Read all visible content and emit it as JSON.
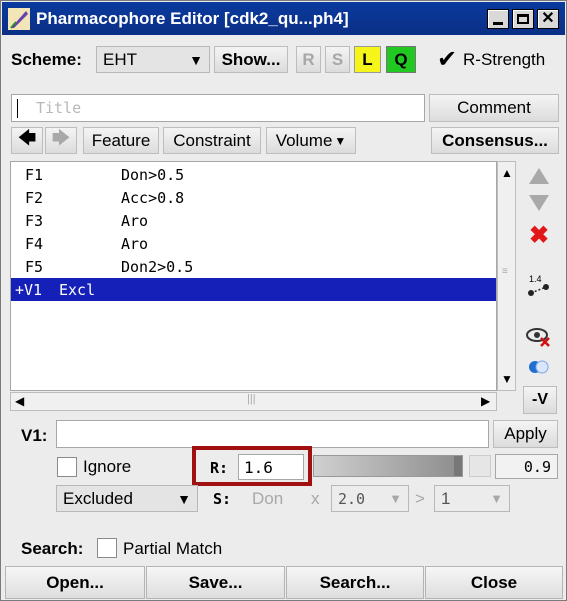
{
  "window": {
    "title": "Pharmacophore Editor [cdk2_qu...ph4]",
    "colors": {
      "titlebar": "#0b3393",
      "selection": "#1520b8",
      "highlight_box": "#a01010",
      "L_button": "#f5f51a",
      "Q_button": "#22c822"
    }
  },
  "toolbar": {
    "scheme_label": "Scheme:",
    "scheme_value": "EHT",
    "show_label": "Show...",
    "r_label": "R",
    "s_label": "S",
    "l_label": "L",
    "q_label": "Q",
    "rstrength_label": "R-Strength"
  },
  "title_field": {
    "placeholder": "Title",
    "value": ""
  },
  "comment_label": "Comment",
  "nav": {
    "feature_label": "Feature",
    "constraint_label": "Constraint",
    "volume_label": "Volume",
    "consensus_label": "Consensus..."
  },
  "features": [
    {
      "id": "F1",
      "expr": "Don>0.5"
    },
    {
      "id": "F2",
      "expr": "Acc>0.8"
    },
    {
      "id": "F3",
      "expr": "Aro"
    },
    {
      "id": "F4",
      "expr": "Aro"
    },
    {
      "id": "F5",
      "expr": "Don2>0.5"
    },
    {
      "id": "+V1",
      "expr": "Excl"
    }
  ],
  "side": {
    "dist_label": "1.4",
    "minus_v_label": "-V"
  },
  "detail": {
    "name_label": "V1:",
    "name_value": "",
    "apply_label": "Apply",
    "ignore_label": "Ignore",
    "r_label": "R:",
    "r_value": "1.6",
    "slider_value": "0.9",
    "type_value": "Excluded",
    "s_label": "S:",
    "s_type": "Don",
    "x_label": "x",
    "x_value": "2.0",
    "gt_label": ">",
    "gt_value": "1"
  },
  "search": {
    "label": "Search:",
    "partial_match_label": "Partial Match"
  },
  "buttons": {
    "open": "Open...",
    "save": "Save...",
    "search": "Search...",
    "close": "Close"
  }
}
